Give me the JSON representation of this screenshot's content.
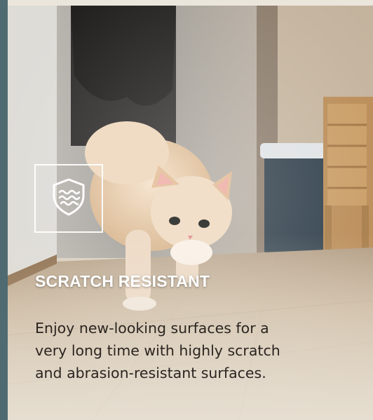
{
  "feature": {
    "title": "SCRATCH RESISTANT",
    "description": "Enjoy new-looking surfaces for a very long time with highly scratch and abrasion-resistant surfaces.",
    "icon": "shield-waves-icon"
  },
  "colors": {
    "accent_bar": "#4f6b71",
    "title_text": "#ffffff",
    "body_text": "#2b2520"
  }
}
